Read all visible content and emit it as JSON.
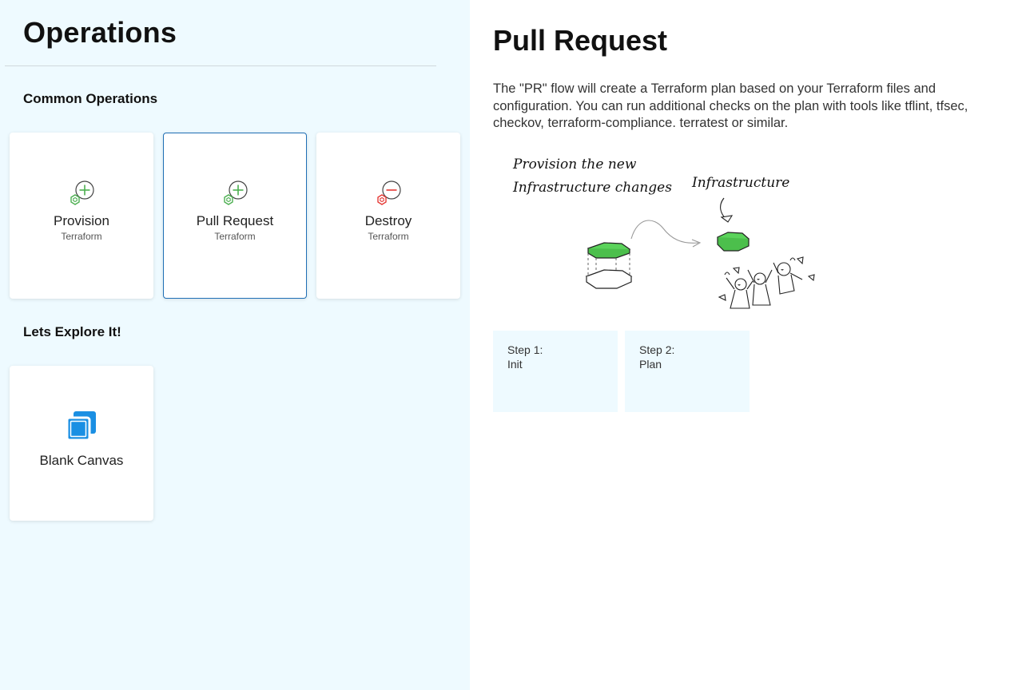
{
  "left": {
    "title": "Operations",
    "common_heading": "Common Operations",
    "explore_heading": "Lets Explore It!",
    "cards": [
      {
        "title": "Provision",
        "subtitle": "Terraform",
        "icon": "provision-icon"
      },
      {
        "title": "Pull Request",
        "subtitle": "Terraform",
        "icon": "pull-request-icon",
        "selected": true
      },
      {
        "title": "Destroy",
        "subtitle": "Terraform",
        "icon": "destroy-icon"
      }
    ],
    "explore_cards": [
      {
        "title": "Blank Canvas",
        "icon": "canvas-icon"
      }
    ]
  },
  "right": {
    "title": "Pull Request",
    "description": "The \"PR\" flow will create a Terraform plan based on your Terraform files and configuration. You can run additional checks on the plan with tools like tflint, tfsec, checkov, terraform-compliance. terratest or similar.",
    "illustration": {
      "caption_line1": "Provision the new",
      "caption_line2": "Infrastructure changes",
      "label": "Infrastructure"
    },
    "steps": [
      {
        "label": "Step 1:",
        "name": "Init"
      },
      {
        "label": "Step 2:",
        "name": "Plan"
      }
    ]
  },
  "colors": {
    "panel_bg": "#eefaff",
    "selected_border": "#1f6fb5",
    "provision_green": "#4caf50",
    "destroy_red": "#e53935",
    "canvas_blue": "#1a8fe3",
    "hexagon_green": "#5bd35b"
  }
}
